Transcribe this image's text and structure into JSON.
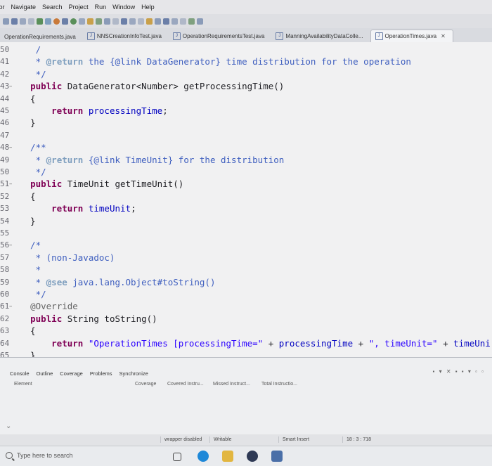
{
  "menu": [
    "tor",
    "Navigate",
    "Search",
    "Project",
    "Run",
    "Window",
    "Help"
  ],
  "tabs": [
    {
      "label": "OperationRequirements.java",
      "active": false
    },
    {
      "label": "NNSCreationInfoTest.java",
      "active": false
    },
    {
      "label": "OperationRequirementsTest.java",
      "active": false
    },
    {
      "label": "ManningAvailabilityDataColle...",
      "active": false
    },
    {
      "label": "OperationTimes.java",
      "active": true
    }
  ],
  "tab_close": "✕",
  "code_lines": [
    {
      "n": "50",
      "t": "   /"
    },
    {
      "n": "41",
      "t": "   * @return the {@link DataGenerator} time distribution for the operation"
    },
    {
      "n": "42",
      "t": "   */"
    },
    {
      "n": "43",
      "t": "  public DataGenerator<Number> getProcessingTime()"
    },
    {
      "n": "44",
      "t": "  {"
    },
    {
      "n": "45",
      "t": "      return processingTime;"
    },
    {
      "n": "46",
      "t": "  }"
    },
    {
      "n": "47",
      "t": ""
    },
    {
      "n": "48",
      "t": "  /**"
    },
    {
      "n": "49",
      "t": "   * @return {@link TimeUnit} for the distribution"
    },
    {
      "n": "50",
      "t": "   */"
    },
    {
      "n": "51",
      "t": "  public TimeUnit getTimeUnit()"
    },
    {
      "n": "52",
      "t": "  {"
    },
    {
      "n": "53",
      "t": "      return timeUnit;"
    },
    {
      "n": "54",
      "t": "  }"
    },
    {
      "n": "55",
      "t": ""
    },
    {
      "n": "56",
      "t": "  /*"
    },
    {
      "n": "57",
      "t": "   * (non-Javadoc)"
    },
    {
      "n": "58",
      "t": "   *"
    },
    {
      "n": "59",
      "t": "   * @see java.lang.Object#toString()"
    },
    {
      "n": "60",
      "t": "   */"
    },
    {
      "n": "61",
      "t": "  @Override"
    },
    {
      "n": "62",
      "t": "  public String toString()"
    },
    {
      "n": "63",
      "t": "  {"
    },
    {
      "n": "64",
      "t": "      return \"OperationTimes [processingTime=\" + processingTime + \", timeUnit=\" + timeUni"
    },
    {
      "n": "65",
      "t": "  }"
    },
    {
      "n": "66",
      "t": ""
    }
  ],
  "panel": {
    "tabs": [
      "Console",
      "Outline",
      "Coverage",
      "Problems",
      "Synchronize"
    ],
    "columns": [
      "Element",
      "Coverage",
      "Covered Instru...",
      "Missed Instruct...",
      "Total Instructio..."
    ]
  },
  "status": {
    "wrapper": "wrapper disabled",
    "writable": "Writable",
    "insert": "Smart Insert",
    "position": "18 : 3 : 718"
  },
  "taskbar": {
    "search_placeholder": "Type here to search"
  },
  "colors": {
    "keyword": "#7f0055",
    "comment": "#3f5fbf",
    "string": "#2a00ff",
    "field": "#0000c0"
  }
}
